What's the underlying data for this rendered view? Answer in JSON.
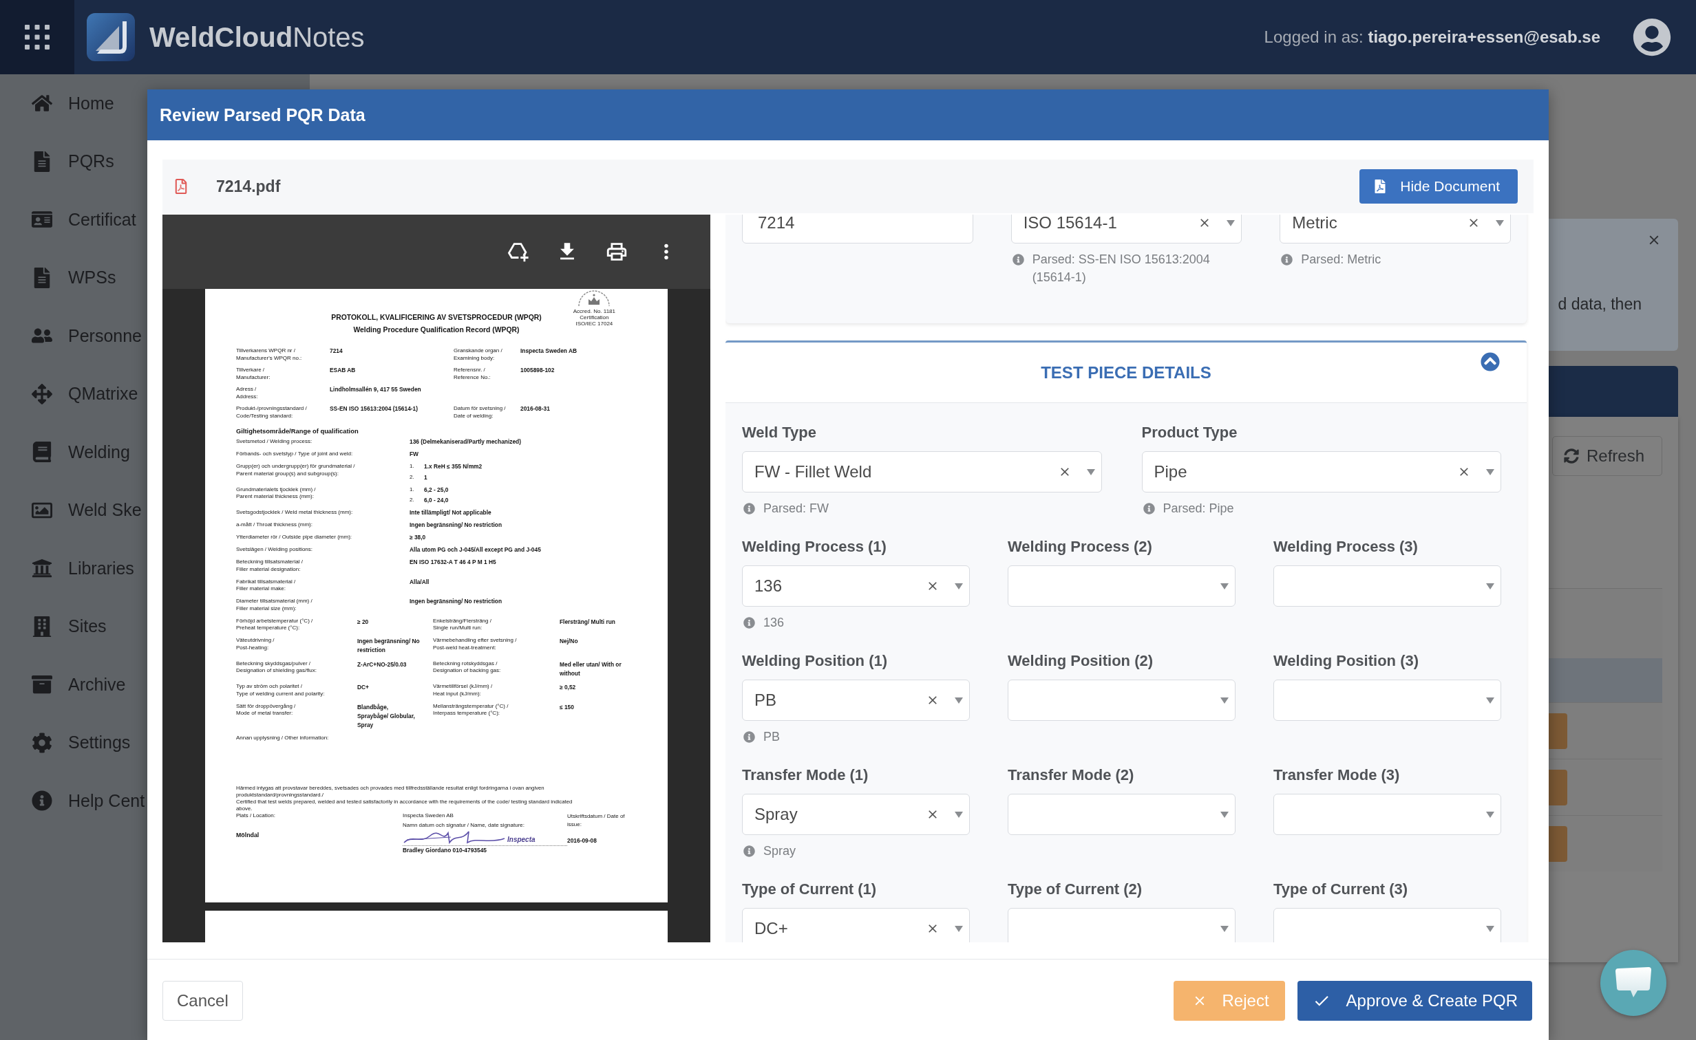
{
  "app_bar": {
    "title": "**WeldCloud**Notes",
    "user": "Logged in as: **tiago.pereira+essen@esab.se**"
  },
  "sidebar": {
    "items": [
      {
        "label": "Home"
      },
      {
        "label": "PQRs"
      },
      {
        "label": "Certificat"
      },
      {
        "label": "WPSs"
      },
      {
        "label": "Personne"
      },
      {
        "label": "QMatrixe"
      },
      {
        "label": "Welding"
      },
      {
        "label": "Weld Ske"
      },
      {
        "label": "Libraries"
      },
      {
        "label": "Sites"
      },
      {
        "label": "Archive"
      },
      {
        "label": "Settings"
      },
      {
        "label": "Help Cent"
      }
    ]
  },
  "background_page": {
    "notice": "d data, then",
    "refresh_button": "Refresh"
  },
  "modal": {
    "title": "Review Parsed PQR Data",
    "file_name": "7214.pdf",
    "hide_document_button": "Hide Document",
    "document": {
      "page": {
        "title": "PROTOKOLL, KVALIFICERING AV SVETSPROCEDUR (WPQR)",
        "subtitle": "Welding Procedure Qualification Record (WPQR)",
        "seal_caption": "Accred. No. 1181\nCertification\nISO/IEC 17024",
        "header_rows": [
          {
            "label": "Tillverkarens WPQR nr /\nManufacturer's WPQR no.:",
            "value": "7214",
            "label_2": "Granskande organ /\nExamining body:",
            "value_2": "Inspecta Sweden AB"
          },
          {
            "label": "Tillverkare /\nManufacturer:",
            "value": "ESAB AB",
            "label_2": "Referensnr. /\nReference No.:",
            "value_2": "1005898-102"
          },
          {
            "label": "Adress /\nAddress:",
            "value": "Lindholmsallén 9, 417 55 Sweden"
          },
          {
            "label": "Produkt-/provningsstandard /\nCode/Testing standard:",
            "value": "SS-EN ISO 15613:2004 (15614-1)",
            "label_2": "Datum för svetsning /\nDate of welding:",
            "value_2": "2016-08-31"
          }
        ],
        "range_title": "Giltighetsområde/Range of qualification",
        "range_rows": [
          {
            "kind": "wide",
            "label": "Svetsmetod / Welding process:",
            "value": "136 (Delmekaniserad/Partly mechanized)"
          },
          {
            "kind": "wide",
            "label": "Förbands- och svetstyp / Type of joint and weld:",
            "value": "FW"
          },
          {
            "kind": "numbered",
            "label": "Grupp(er) och undergrupp(er) för grundmaterial /\nParent material group(s) and subgroup(s):",
            "items": [
              {
                "number": "1.",
                "value": "1.x ReH ≤ 355 N/mm2"
              },
              {
                "number": "2.",
                "value": "1"
              }
            ]
          },
          {
            "kind": "numbered",
            "label": "Grundmaterialets tjocklek (mm) /\nParent material thickness (mm):",
            "items": [
              {
                "number": "1.",
                "value": "6,2 - 25,0"
              },
              {
                "number": "2.",
                "value": "6,0 - 24,0"
              }
            ]
          },
          {
            "kind": "wide",
            "label": "Svetsgodstjocklek / Weld metal thickness (mm):",
            "value": "Inte tillämpligt/ Not applicable"
          },
          {
            "kind": "wide",
            "label": "a-mått / Throat thickness (mm):",
            "value": "Ingen begränsning/ No restriction"
          },
          {
            "kind": "wide",
            "label": "Ytterdiameter rör / Outside pipe diameter (mm):",
            "value": "≥ 38,0"
          },
          {
            "kind": "wide",
            "label": "Svetslägen / Welding positions:",
            "value": "Alla utom PG och J-045/All except PG and J-045"
          },
          {
            "kind": "wide",
            "label": "Beteckning tillsatsmaterial /\nFiller material designation:",
            "value": "EN ISO 17632-A T 46 4 P M 1 H5"
          },
          {
            "kind": "wide",
            "label": "Fabrikat tillsatsmaterial /\nFiller material make:",
            "value": "Alla/All"
          },
          {
            "kind": "wide",
            "label": "Diameter tillsatsmaterial (mm) /\nFiller material size (mm):",
            "value": "Ingen begränsning/ No restriction"
          },
          {
            "kind": "split",
            "label": "Förhöjd arbetstemperatur (°C) /\nPreheat temperature (°C):",
            "value": "≥ 20",
            "label_2": "Enkelsträng/Flersträng /\nSingle run/Multi run:",
            "value_2": "Flersträng/ Multi run"
          },
          {
            "kind": "split",
            "label": "Väteutdrivning /\nPost-heating:",
            "value": "Ingen begränsning/ No\nrestriction",
            "label_2": "Värmebehandling efter svetsning /\nPost-weld heat-treatment:",
            "value_2": "Nej/No"
          },
          {
            "kind": "split",
            "label": "Beteckning skyddsgas/pulver /\nDesignation of shielding gas/flux:",
            "value": "Z-ArC+NO-25/0.03",
            "label_2": "Beteckning rotskyddsgas /\nDesignation of backing gas:",
            "value_2": "Med eller utan/ With or\nwithout"
          },
          {
            "kind": "split",
            "label": "Typ av ström och polaritet /\nType of welding current and polarity:",
            "value": "DC+",
            "label_2": "Värmetillförsel (kJ/mm) /\nHeat input (kJ/mm):",
            "value_2": "≥ 0,52"
          },
          {
            "kind": "split",
            "label": "Sätt för droppövergång /\nMode of metal transfer:",
            "value": "Blandbåge,\nSpraybåge/ Globular,\nSpray",
            "label_2": "Mellansträngstemperatur (°C) /\nInterpass temperature (°C):",
            "value_2": "≤ 150"
          }
        ],
        "other_info_label": "Annan upplysning / Other information:",
        "statement_sv": "Härmed intygas att provstavar bereddes, svetsades och provades med tillfredsställande resultat enligt fordringarna i ovan angiven\nproduktstandard/provningsstandard./",
        "statement_en": "Certified that test welds prepared, welded and tested satisfactorily in accordance with the requirements of the code/ testing standard indicated\nabove.",
        "location_label": "Plats / Location:",
        "location": "Mölndal",
        "examiner": "Inspecta Sweden AB",
        "signature_label": "Namn datum och signatur / Name, date signature:",
        "stamp": "Inspecta",
        "signer": "Bradley Giordano 010-4793545",
        "issue_label": "Utskriftsdatum / Date of\nissue:",
        "issue_date": "2016-09-08"
      }
    },
    "form": {
      "top_fields": [
        {
          "kind": "input",
          "value": "7214"
        },
        {
          "kind": "select",
          "value": "ISO 15614-1",
          "parsed": "Parsed: SS-EN ISO 15613:2004 (15614-1)"
        },
        {
          "kind": "select",
          "value": "Metric",
          "parsed": "Parsed: Metric"
        }
      ],
      "section": {
        "title": "TEST PIECE DETAILS",
        "expanded": true,
        "rows": [
          {
            "fields": [
              {
                "label": "Weld Type",
                "value": "FW - Fillet Weld",
                "parsed": "Parsed: FW"
              },
              {
                "label": "Product Type",
                "value": "Pipe",
                "parsed": "Parsed: Pipe"
              }
            ]
          },
          {
            "fields": [
              {
                "label": "Welding Process (1)",
                "value": "136",
                "parsed": "136"
              },
              {
                "label": "Welding Process (2)"
              },
              {
                "label": "Welding Process (3)"
              }
            ]
          },
          {
            "fields": [
              {
                "label": "Welding Position (1)",
                "value": "PB",
                "parsed": "PB"
              },
              {
                "label": "Welding Position (2)"
              },
              {
                "label": "Welding Position (3)"
              }
            ]
          },
          {
            "fields": [
              {
                "label": "Transfer Mode (1)",
                "value": "Spray",
                "parsed": "Spray"
              },
              {
                "label": "Transfer Mode (2)"
              },
              {
                "label": "Transfer Mode (3)"
              }
            ]
          },
          {
            "fields": [
              {
                "label": "Type of Current (1)",
                "value": "DC+"
              },
              {
                "label": "Type of Current (2)"
              },
              {
                "label": "Type of Current (3)"
              }
            ]
          }
        ]
      }
    },
    "buttons": [
      {
        "kind": "cancel",
        "label": "Cancel"
      },
      {
        "kind": "reject",
        "label": "Reject"
      },
      {
        "kind": "approve",
        "label": "Approve & Create PQR"
      }
    ]
  }
}
